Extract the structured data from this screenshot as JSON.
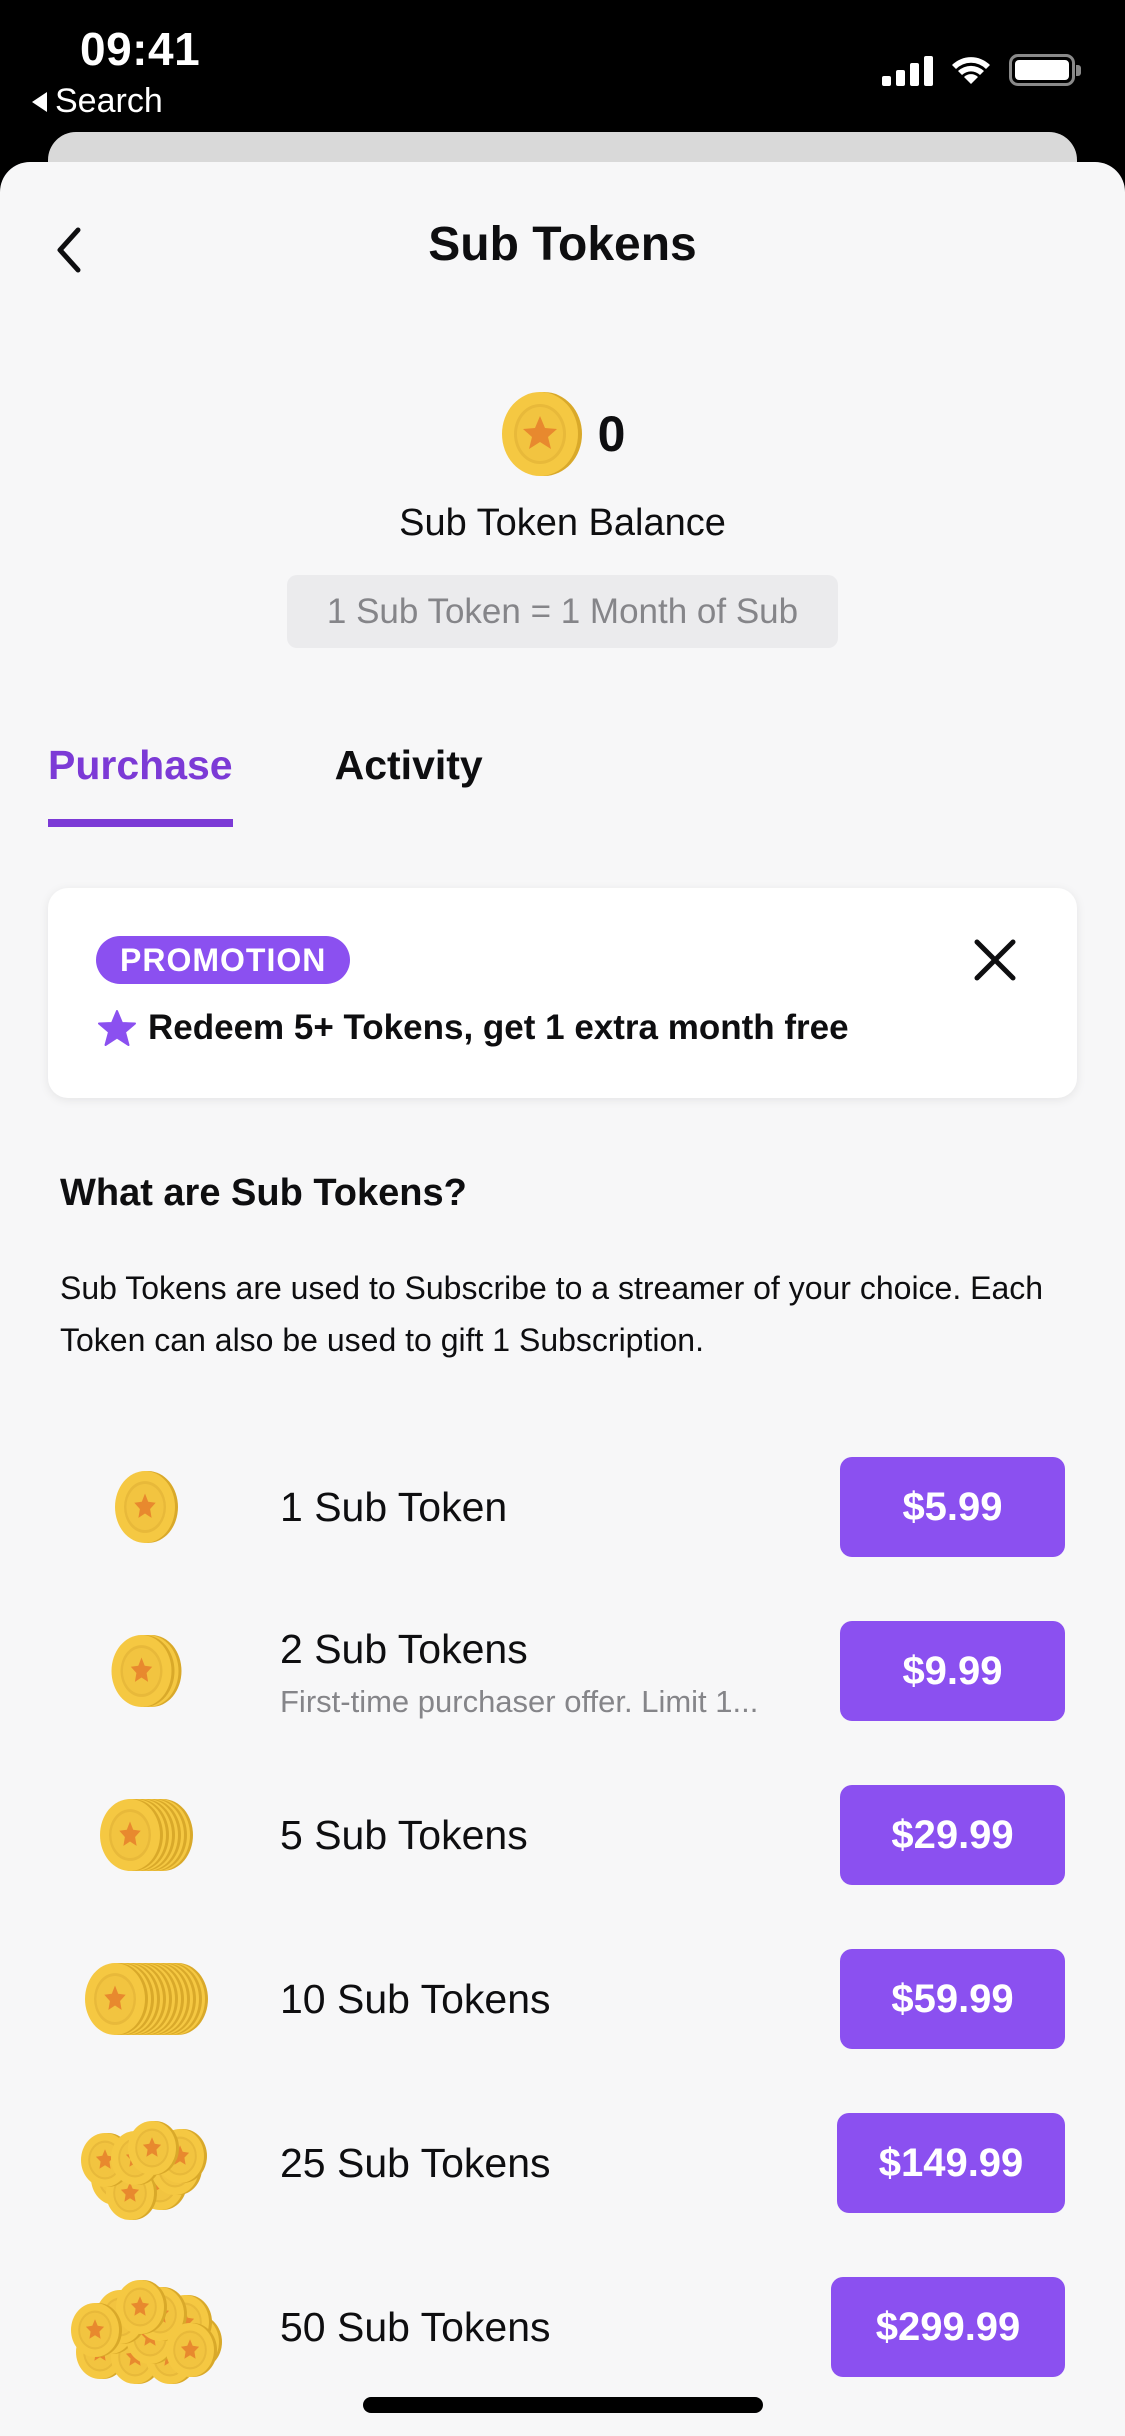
{
  "status_bar": {
    "time": "09:41",
    "back_app_label": "Search"
  },
  "nav": {
    "title": "Sub Tokens",
    "back_icon": "chevron-left-icon"
  },
  "balance": {
    "icon": "coin-icon",
    "value": "0",
    "label": "Sub Token Balance",
    "rate_text": "1 Sub Token = 1 Month of Sub"
  },
  "tabs": [
    {
      "label": "Purchase",
      "active": true
    },
    {
      "label": "Activity",
      "active": false
    }
  ],
  "promo": {
    "badge": "PROMOTION",
    "icon": "star-icon",
    "text": "Redeem 5+ Tokens, get 1 extra month free",
    "close_icon": "close-icon"
  },
  "info": {
    "title": "What are Sub Tokens?",
    "body": "Sub Tokens are used to Subscribe to a streamer of your choice. Each Token can also be used to gift 1 Subscription."
  },
  "products": [
    {
      "name": "1 Sub Token",
      "subtitle": "",
      "price": "$5.99",
      "coin_count": 1
    },
    {
      "name": "2 Sub Tokens",
      "subtitle": "First-time purchaser offer. Limit 1...",
      "price": "$9.99",
      "coin_count": 2
    },
    {
      "name": "5 Sub Tokens",
      "subtitle": "",
      "price": "$29.99",
      "coin_count": 5
    },
    {
      "name": "10 Sub Tokens",
      "subtitle": "",
      "price": "$59.99",
      "coin_count": 10
    },
    {
      "name": "25 Sub Tokens",
      "subtitle": "",
      "price": "$149.99",
      "coin_count": 25
    },
    {
      "name": "50 Sub Tokens",
      "subtitle": "",
      "price": "$299.99",
      "coin_count": 50
    }
  ],
  "colors": {
    "accent": "#8b50f0",
    "tab_active": "#7c3ad6",
    "background": "#f7f7f8",
    "coin_gold": "#f5c842",
    "coin_star": "#e8892e"
  }
}
